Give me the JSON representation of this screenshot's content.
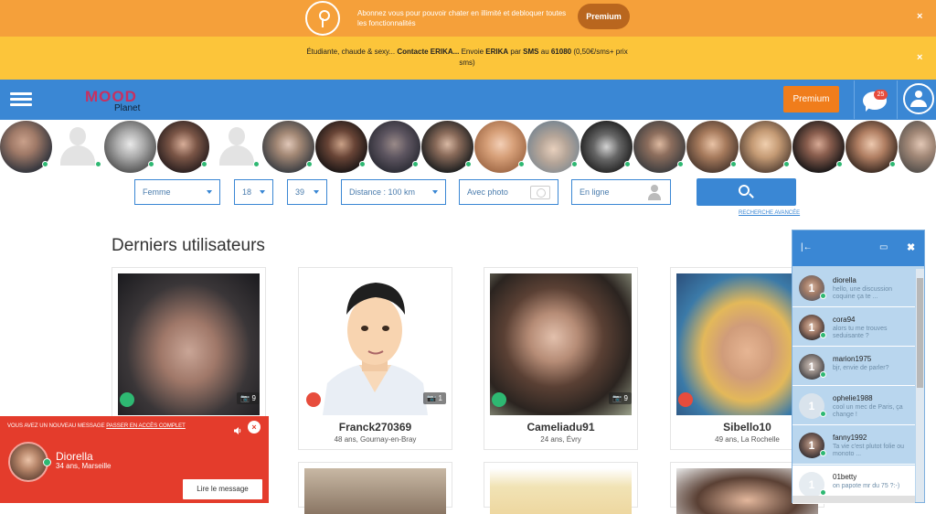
{
  "promo": {
    "text": "Abonnez vous pour pouvoir chater en illimité et debloquer toutes les fonctionnalités",
    "button": "Premium",
    "close": "×",
    "color": "#f5a03a"
  },
  "sms_banner": {
    "part1": "Étudiante, chaude & sexy... ",
    "contact": "Contacte ERIKA...",
    "part2": " Envoie ",
    "erika": "ERIKA",
    "part3": " par ",
    "sms": "SMS",
    "part4": " au ",
    "number": "61080",
    "part5": " (0,50€/sms+ prix sms)",
    "close": "×"
  },
  "navbar": {
    "logo_mood": "MOOD",
    "logo_planet": "Planet",
    "premium": "Premium",
    "chat_badge": "25",
    "bg": "#3a87d4"
  },
  "filters": {
    "gender": "Femme",
    "age_min": "18",
    "age_max": "39",
    "distance": "Distance : 100 km",
    "photo": "Avec photo",
    "online": "En ligne",
    "advanced": "RECHERCHE AVANCÉE"
  },
  "section_title": "Derniers utilisateurs",
  "users": [
    {
      "name": "",
      "meta": "",
      "photos": "9"
    },
    {
      "name": "Franck270369",
      "meta": "48 ans, Gournay-en-Bray",
      "photos": "1"
    },
    {
      "name": "Cameliadu91",
      "meta": "24 ans, Évry",
      "photos": "9"
    },
    {
      "name": "Sibello10",
      "meta": "49 ans, La Rochelle",
      "photos": ""
    }
  ],
  "notification": {
    "header": "VOUS AVEZ UN NOUVEAU MESSAGE ",
    "header_link": "PASSER EN ACCÈS COMPLET",
    "close": "×",
    "name": "Diorella",
    "meta": "34 ans, Marseille",
    "button": "Lire le message"
  },
  "chat": {
    "pin": "|←",
    "minimize": "▭",
    "close": "✖",
    "items": [
      {
        "name": "diorella",
        "msg": "hello, une discussion coquine ça te ...",
        "count": "1"
      },
      {
        "name": "cora94",
        "msg": "alors tu me trouves seduisante ?",
        "count": "1"
      },
      {
        "name": "marion1975",
        "msg": "bjr, envie de parler?",
        "count": "1"
      },
      {
        "name": "ophelie1988",
        "msg": "cool un mec de Paris, ça change !",
        "count": "1"
      },
      {
        "name": "fanny1992",
        "msg": "Ta vie c'est plutot folie ou monoto ...",
        "count": "1"
      },
      {
        "name": "01betty",
        "msg": "on papote mr du 75 ?:-)",
        "count": "1"
      }
    ]
  }
}
